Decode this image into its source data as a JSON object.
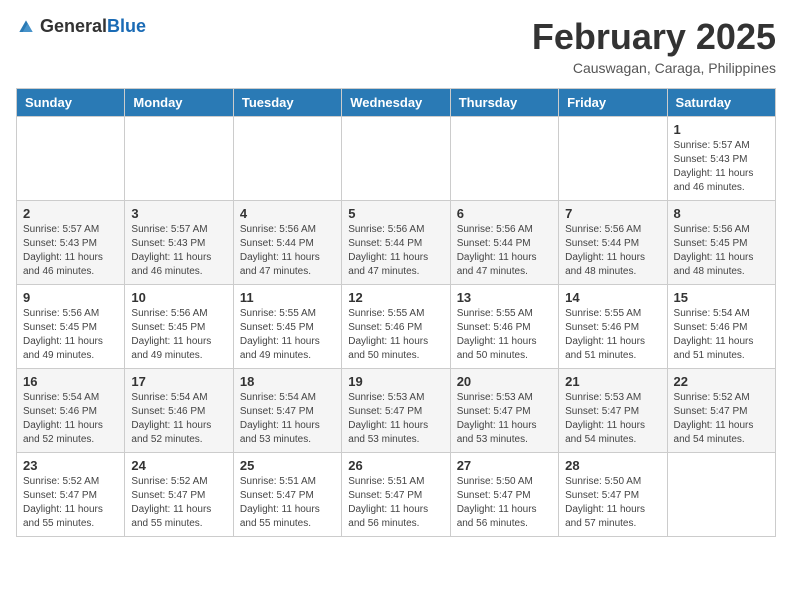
{
  "header": {
    "logo_general": "General",
    "logo_blue": "Blue",
    "month_year": "February 2025",
    "location": "Causwagan, Caraga, Philippines"
  },
  "weekdays": [
    "Sunday",
    "Monday",
    "Tuesday",
    "Wednesday",
    "Thursday",
    "Friday",
    "Saturday"
  ],
  "weeks": [
    [
      {
        "day": "",
        "info": ""
      },
      {
        "day": "",
        "info": ""
      },
      {
        "day": "",
        "info": ""
      },
      {
        "day": "",
        "info": ""
      },
      {
        "day": "",
        "info": ""
      },
      {
        "day": "",
        "info": ""
      },
      {
        "day": "1",
        "info": "Sunrise: 5:57 AM\nSunset: 5:43 PM\nDaylight: 11 hours\nand 46 minutes."
      }
    ],
    [
      {
        "day": "2",
        "info": "Sunrise: 5:57 AM\nSunset: 5:43 PM\nDaylight: 11 hours\nand 46 minutes."
      },
      {
        "day": "3",
        "info": "Sunrise: 5:57 AM\nSunset: 5:43 PM\nDaylight: 11 hours\nand 46 minutes."
      },
      {
        "day": "4",
        "info": "Sunrise: 5:56 AM\nSunset: 5:44 PM\nDaylight: 11 hours\nand 47 minutes."
      },
      {
        "day": "5",
        "info": "Sunrise: 5:56 AM\nSunset: 5:44 PM\nDaylight: 11 hours\nand 47 minutes."
      },
      {
        "day": "6",
        "info": "Sunrise: 5:56 AM\nSunset: 5:44 PM\nDaylight: 11 hours\nand 47 minutes."
      },
      {
        "day": "7",
        "info": "Sunrise: 5:56 AM\nSunset: 5:44 PM\nDaylight: 11 hours\nand 48 minutes."
      },
      {
        "day": "8",
        "info": "Sunrise: 5:56 AM\nSunset: 5:45 PM\nDaylight: 11 hours\nand 48 minutes."
      }
    ],
    [
      {
        "day": "9",
        "info": "Sunrise: 5:56 AM\nSunset: 5:45 PM\nDaylight: 11 hours\nand 49 minutes."
      },
      {
        "day": "10",
        "info": "Sunrise: 5:56 AM\nSunset: 5:45 PM\nDaylight: 11 hours\nand 49 minutes."
      },
      {
        "day": "11",
        "info": "Sunrise: 5:55 AM\nSunset: 5:45 PM\nDaylight: 11 hours\nand 49 minutes."
      },
      {
        "day": "12",
        "info": "Sunrise: 5:55 AM\nSunset: 5:46 PM\nDaylight: 11 hours\nand 50 minutes."
      },
      {
        "day": "13",
        "info": "Sunrise: 5:55 AM\nSunset: 5:46 PM\nDaylight: 11 hours\nand 50 minutes."
      },
      {
        "day": "14",
        "info": "Sunrise: 5:55 AM\nSunset: 5:46 PM\nDaylight: 11 hours\nand 51 minutes."
      },
      {
        "day": "15",
        "info": "Sunrise: 5:54 AM\nSunset: 5:46 PM\nDaylight: 11 hours\nand 51 minutes."
      }
    ],
    [
      {
        "day": "16",
        "info": "Sunrise: 5:54 AM\nSunset: 5:46 PM\nDaylight: 11 hours\nand 52 minutes."
      },
      {
        "day": "17",
        "info": "Sunrise: 5:54 AM\nSunset: 5:46 PM\nDaylight: 11 hours\nand 52 minutes."
      },
      {
        "day": "18",
        "info": "Sunrise: 5:54 AM\nSunset: 5:47 PM\nDaylight: 11 hours\nand 53 minutes."
      },
      {
        "day": "19",
        "info": "Sunrise: 5:53 AM\nSunset: 5:47 PM\nDaylight: 11 hours\nand 53 minutes."
      },
      {
        "day": "20",
        "info": "Sunrise: 5:53 AM\nSunset: 5:47 PM\nDaylight: 11 hours\nand 53 minutes."
      },
      {
        "day": "21",
        "info": "Sunrise: 5:53 AM\nSunset: 5:47 PM\nDaylight: 11 hours\nand 54 minutes."
      },
      {
        "day": "22",
        "info": "Sunrise: 5:52 AM\nSunset: 5:47 PM\nDaylight: 11 hours\nand 54 minutes."
      }
    ],
    [
      {
        "day": "23",
        "info": "Sunrise: 5:52 AM\nSunset: 5:47 PM\nDaylight: 11 hours\nand 55 minutes."
      },
      {
        "day": "24",
        "info": "Sunrise: 5:52 AM\nSunset: 5:47 PM\nDaylight: 11 hours\nand 55 minutes."
      },
      {
        "day": "25",
        "info": "Sunrise: 5:51 AM\nSunset: 5:47 PM\nDaylight: 11 hours\nand 55 minutes."
      },
      {
        "day": "26",
        "info": "Sunrise: 5:51 AM\nSunset: 5:47 PM\nDaylight: 11 hours\nand 56 minutes."
      },
      {
        "day": "27",
        "info": "Sunrise: 5:50 AM\nSunset: 5:47 PM\nDaylight: 11 hours\nand 56 minutes."
      },
      {
        "day": "28",
        "info": "Sunrise: 5:50 AM\nSunset: 5:47 PM\nDaylight: 11 hours\nand 57 minutes."
      },
      {
        "day": "",
        "info": ""
      }
    ]
  ]
}
